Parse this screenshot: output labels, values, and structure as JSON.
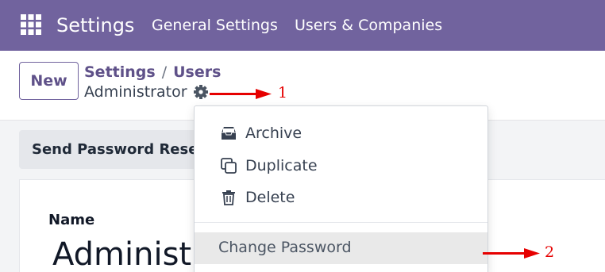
{
  "topbar": {
    "app_title": "Settings",
    "nav": [
      "General Settings",
      "Users & Companies"
    ],
    "background": "#71639e"
  },
  "control_panel": {
    "new_label": "New",
    "breadcrumb": [
      "Settings",
      "Users"
    ],
    "record_name": "Administrator"
  },
  "status_bar": {
    "reset_password_label": "Send Password Reset"
  },
  "form": {
    "name_label": "Name",
    "name_value": "Administrator"
  },
  "actions_menu": {
    "items": [
      {
        "label": "Archive",
        "icon": "archive-icon"
      },
      {
        "label": "Duplicate",
        "icon": "duplicate-icon"
      },
      {
        "label": "Delete",
        "icon": "trash-icon"
      }
    ],
    "change_password_label": "Change Password"
  },
  "annotations": {
    "label_1": "1",
    "label_2": "2",
    "color": "#e60000"
  }
}
